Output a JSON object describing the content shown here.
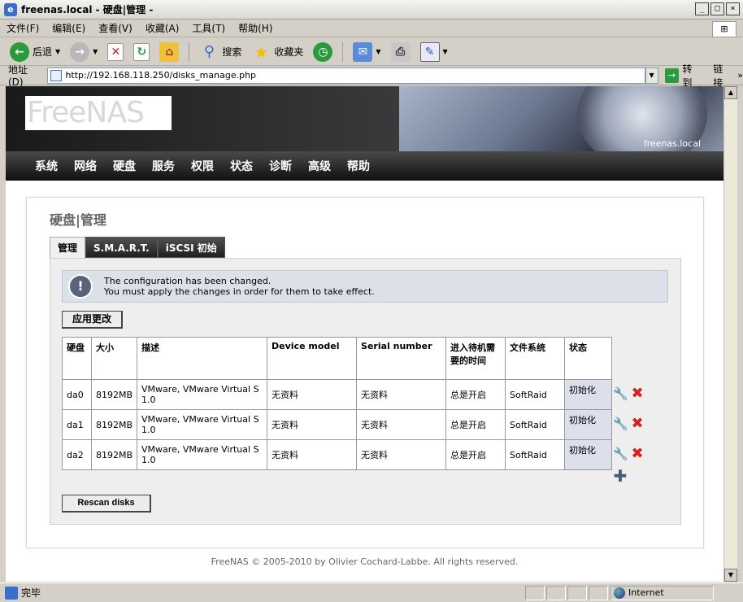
{
  "window": {
    "title": "freenas.local - 硬盘|管理 -"
  },
  "menubar": [
    "文件(F)",
    "编辑(E)",
    "查看(V)",
    "收藏(A)",
    "工具(T)",
    "帮助(H)"
  ],
  "toolbar": {
    "back_label": "后退",
    "search_label": "搜索",
    "favorites_label": "收藏夹"
  },
  "addressbar": {
    "label": "地址(D)",
    "url": "http://192.168.118.250/disks_manage.php",
    "goto_label": "转到",
    "links_label": "链接"
  },
  "header": {
    "logo_text": "FreeNAS",
    "hostname": "freenas.local"
  },
  "nav": [
    "系统",
    "网络",
    "硬盘",
    "服务",
    "权限",
    "状态",
    "诊断",
    "高级",
    "帮助"
  ],
  "page": {
    "title": "硬盘|管理",
    "tabs": [
      "管理",
      "S.M.A.R.T.",
      "iSCSI 初始"
    ],
    "info_line1": "The configuration has been changed.",
    "info_line2": "You must apply the changes in order for them to take effect.",
    "apply_label": "应用更改",
    "rescan_label": "Rescan disks"
  },
  "table": {
    "headers": [
      "硬盘",
      "大小",
      "描述",
      "Device model",
      "Serial number",
      "进入待机需要的时间",
      "文件系统",
      "状态"
    ],
    "rows": [
      [
        "da0",
        "8192MB",
        "VMware, VMware Virtual S 1.0",
        "无资料",
        "无资料",
        "总是开启",
        "SoftRaid",
        "初始化"
      ],
      [
        "da1",
        "8192MB",
        "VMware, VMware Virtual S 1.0",
        "无资料",
        "无资料",
        "总是开启",
        "SoftRaid",
        "初始化"
      ],
      [
        "da2",
        "8192MB",
        "VMware, VMware Virtual S 1.0",
        "无资料",
        "无资料",
        "总是开启",
        "SoftRaid",
        "初始化"
      ]
    ]
  },
  "footer": "FreeNAS © 2005-2010 by Olivier Cochard-Labbe. All rights reserved.",
  "statusbar": {
    "text": "完毕",
    "zone": "Internet"
  }
}
